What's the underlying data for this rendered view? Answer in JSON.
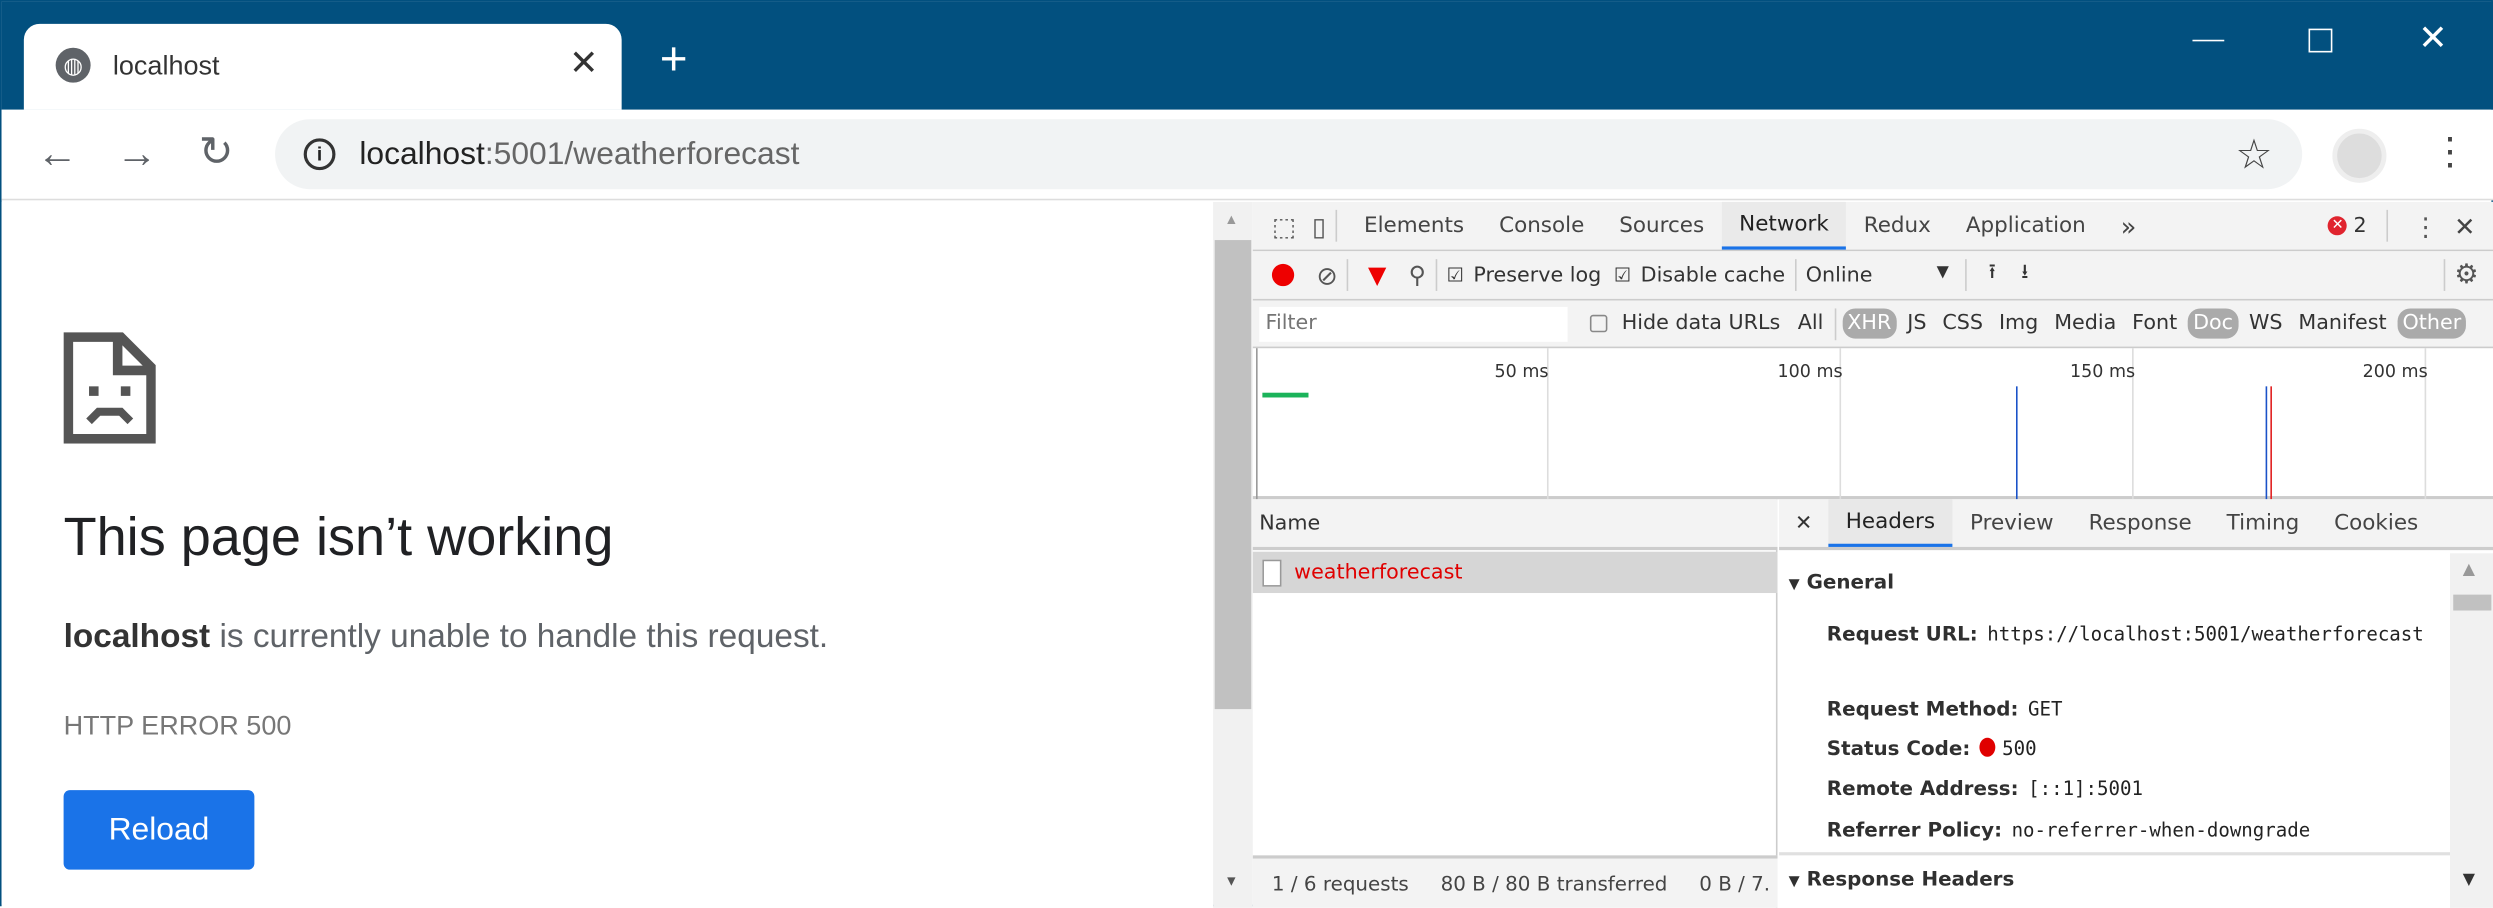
{
  "browser": {
    "tab_title": "localhost",
    "url_host": "localhost",
    "url_rest": ":5001/weatherforecast"
  },
  "page": {
    "title": "This page isn’t working",
    "desc_bold": "localhost",
    "desc_rest": " is currently unable to handle this request.",
    "error_code": "HTTP ERROR 500",
    "reload_label": "Reload"
  },
  "devtools": {
    "tabs": [
      "Elements",
      "Console",
      "Sources",
      "Network",
      "Redux",
      "Application"
    ],
    "more": "»",
    "error_count": "2",
    "toolbar": {
      "preserve_log": "Preserve log",
      "disable_cache": "Disable cache",
      "throttle": "Online"
    },
    "filter": {
      "placeholder": "Filter",
      "hide_data_urls": "Hide data URLs",
      "types": [
        "All",
        "XHR",
        "JS",
        "CSS",
        "Img",
        "Media",
        "Font",
        "Doc",
        "WS",
        "Manifest",
        "Other"
      ]
    },
    "timeline": {
      "ticks": [
        "50 ms",
        "100 ms",
        "150 ms",
        "200 ms"
      ]
    },
    "name_header": "Name",
    "requests": [
      {
        "name": "weatherforecast",
        "status_color": "#e00000"
      }
    ],
    "detail_tabs": [
      "Headers",
      "Preview",
      "Response",
      "Timing",
      "Cookies"
    ],
    "general": {
      "title": "General",
      "rows": [
        {
          "k": "Request URL:",
          "v": "https://localhost:5001/weatherforecast"
        },
        {
          "k": "Request Method:",
          "v": "GET"
        },
        {
          "k": "Status Code:",
          "v": "500"
        },
        {
          "k": "Remote Address:",
          "v": "[::1]:5001"
        },
        {
          "k": "Referrer Policy:",
          "v": "no-referrer-when-downgrade"
        }
      ]
    },
    "response_headers_title": "Response Headers",
    "status": {
      "requests": "1 / 6 requests",
      "transferred": "80 B / 80 B transferred",
      "resources": "0 B / 7."
    }
  },
  "colors": {
    "titlebar": "#02507f",
    "accent": "#1a73e8",
    "error": "#e00000"
  }
}
